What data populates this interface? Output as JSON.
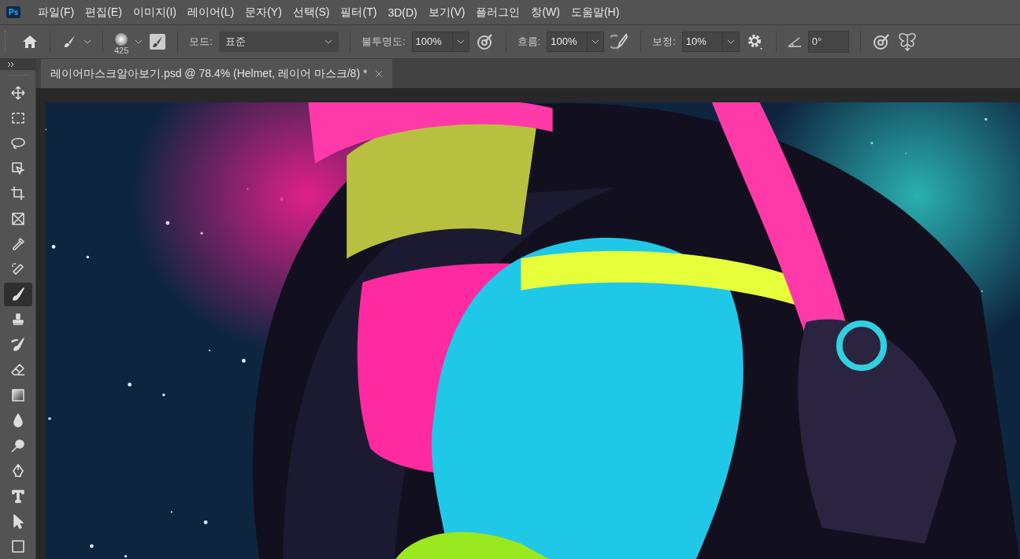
{
  "app_icon": {
    "label": "Ps"
  },
  "menu": [
    "파일(F)",
    "편집(E)",
    "이미지(I)",
    "레이어(L)",
    "문자(Y)",
    "선택(S)",
    "필터(T)",
    "3D(D)",
    "보기(V)",
    "플러그인",
    "창(W)",
    "도움말(H)"
  ],
  "options_bar": {
    "brush_size": "425",
    "mode": {
      "label": "모드:",
      "value": "표준"
    },
    "opacity": {
      "label": "불투명도:",
      "value": "100%"
    },
    "flow": {
      "label": "흐름:",
      "value": "100%"
    },
    "smoothing": {
      "label": "보정:",
      "value": "10%"
    },
    "angle": {
      "value": "0°"
    }
  },
  "document_tabs": [
    {
      "title": "레이어마스크알아보기.psd @ 78.4% (Helmet, 레이어 마스크/8) *",
      "selected": true
    }
  ],
  "tools": [
    {
      "kind": "move",
      "selected": false
    },
    {
      "kind": "marquee",
      "selected": false
    },
    {
      "kind": "lasso",
      "selected": false
    },
    {
      "kind": "object",
      "selected": false
    },
    {
      "kind": "crop",
      "selected": false
    },
    {
      "kind": "frame",
      "selected": false
    },
    {
      "kind": "eyedropper",
      "selected": false
    },
    {
      "kind": "healing",
      "selected": false
    },
    {
      "kind": "brush",
      "selected": true
    },
    {
      "kind": "stamp",
      "selected": false
    },
    {
      "kind": "history",
      "selected": false
    },
    {
      "kind": "eraser",
      "selected": false
    },
    {
      "kind": "gradient",
      "selected": false
    },
    {
      "kind": "blur",
      "selected": false
    },
    {
      "kind": "dodge",
      "selected": false
    },
    {
      "kind": "pen",
      "selected": false
    },
    {
      "kind": "type",
      "selected": false
    },
    {
      "kind": "select",
      "selected": false
    },
    {
      "kind": "shape",
      "selected": false
    }
  ]
}
